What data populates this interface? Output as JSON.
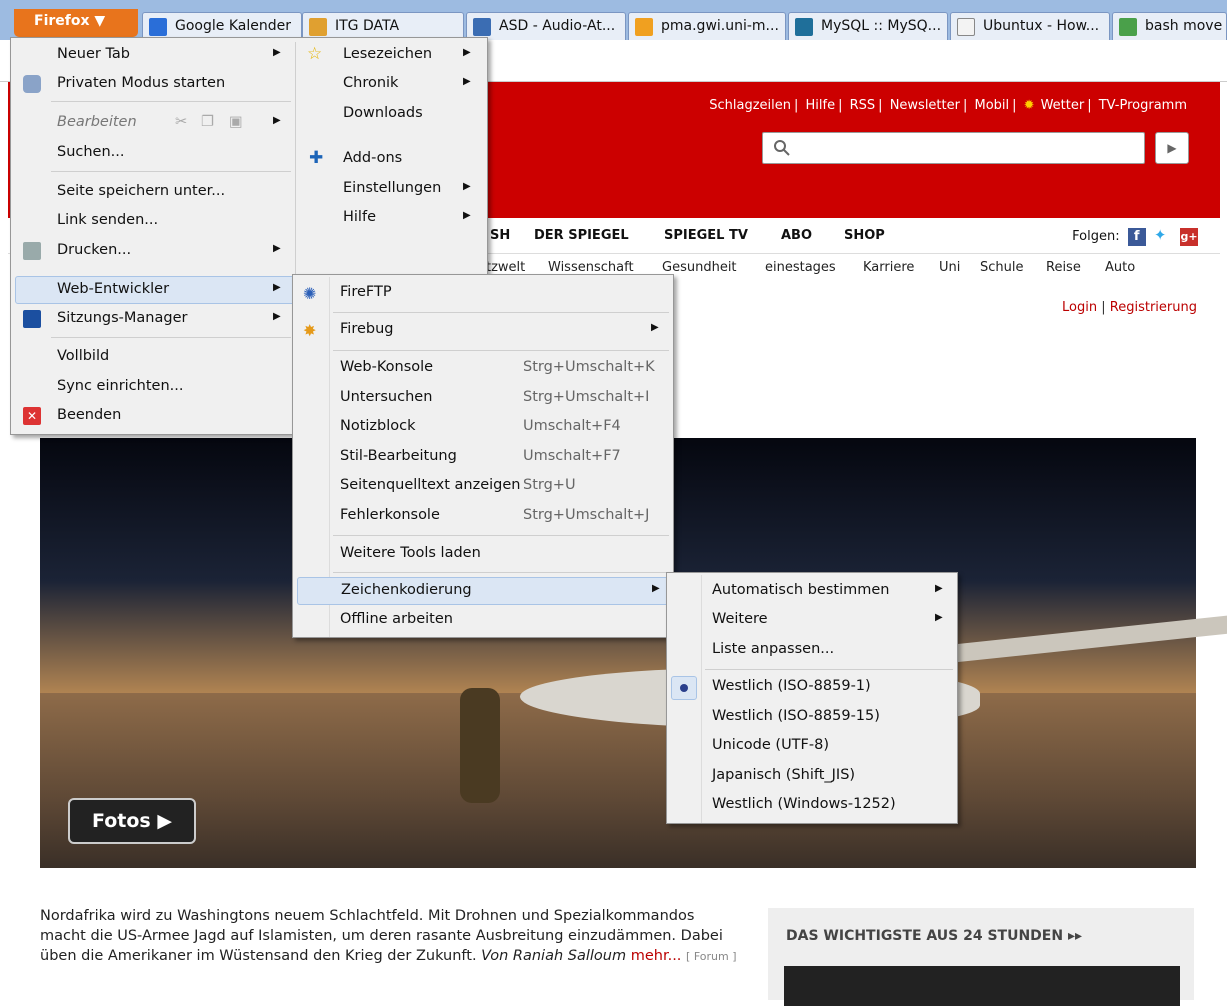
{
  "browser": {
    "firefox_button": "Firefox ▼",
    "tabs": [
      {
        "title": "Google Kalender",
        "icon": "calendar-icon"
      },
      {
        "title": "ITG DATA",
        "icon": "itg-icon"
      },
      {
        "title": "ASD - Audio-At...",
        "icon": "asd-icon"
      },
      {
        "title": "pma.gwi.uni-m...",
        "icon": "phpmyadmin-icon"
      },
      {
        "title": "MySQL :: MySQ...",
        "icon": "mysql-icon"
      },
      {
        "title": "Ubuntux - How...",
        "icon": "ubuntux-icon"
      },
      {
        "title": "bash move",
        "icon": "google-icon"
      }
    ]
  },
  "site": {
    "top_links": [
      "Schlagzeilen",
      "Hilfe",
      "RSS",
      "Newsletter",
      "Mobil",
      "Wetter",
      "TV-Programm"
    ],
    "nav": [
      "SH",
      "DER SPIEGEL",
      "SPIEGEL TV",
      "ABO",
      "SHOP"
    ],
    "folgen": "Folgen:",
    "subnav": [
      "tzwelt",
      "Wissenschaft",
      "Gesundheit",
      "einestages",
      "Karriere",
      "Uni",
      "Schule",
      "Reise",
      "Auto"
    ],
    "login": "Login",
    "register": "Registrierung",
    "fotos_button": "Fotos ▶",
    "article_text": "Nordafrika wird zu Washingtons neuem Schlachtfeld. Mit Drohnen und Spezialkommandos macht die US-Armee Jagd auf Islamisten, um deren rasante Ausbreitung einzudämmen. Dabei üben die Amerikaner im Wüstensand den Krieg der Zukunft.",
    "article_author": "Von Raniah Salloum",
    "article_more": "mehr...",
    "article_forum": "[ Forum ]",
    "wichtig_title": "DAS WICHTIGSTE AUS 24 STUNDEN ▸▸"
  },
  "menus": {
    "main_left": [
      "Neuer Tab",
      "Privaten Modus starten",
      "Bearbeiten",
      "Suchen...",
      "Seite speichern unter...",
      "Link senden...",
      "Drucken...",
      "Web-Entwickler",
      "Sitzungs-Manager",
      "Vollbild",
      "Sync einrichten...",
      "Beenden"
    ],
    "main_right": [
      "Lesezeichen",
      "Chronik",
      "Downloads",
      "Add-ons",
      "Einstellungen",
      "Hilfe"
    ],
    "webdev": {
      "items": [
        "FireFTP",
        "Firebug",
        "Web-Konsole",
        "Untersuchen",
        "Notizblock",
        "Stil-Bearbeitung",
        "Seitenquelltext anzeigen",
        "Fehlerkonsole",
        "Weitere Tools laden",
        "Zeichenkodierung",
        "Offline arbeiten"
      ],
      "shortcuts": [
        "Strg+Umschalt+K",
        "Strg+Umschalt+I",
        "Umschalt+F4",
        "Umschalt+F7",
        "Strg+U",
        "Strg+Umschalt+J"
      ]
    },
    "encoding": [
      "Automatisch bestimmen",
      "Weitere",
      "Liste anpassen...",
      "Westlich (ISO-8859-1)",
      "Westlich (ISO-8859-15)",
      "Unicode (UTF-8)",
      "Japanisch (Shift_JIS)",
      "Westlich (Windows-1252)"
    ]
  },
  "colors": {
    "spiegel_red": "#cc0000",
    "firefox_orange": "#e8741c",
    "menu_highlight": "#dbe6f4"
  }
}
